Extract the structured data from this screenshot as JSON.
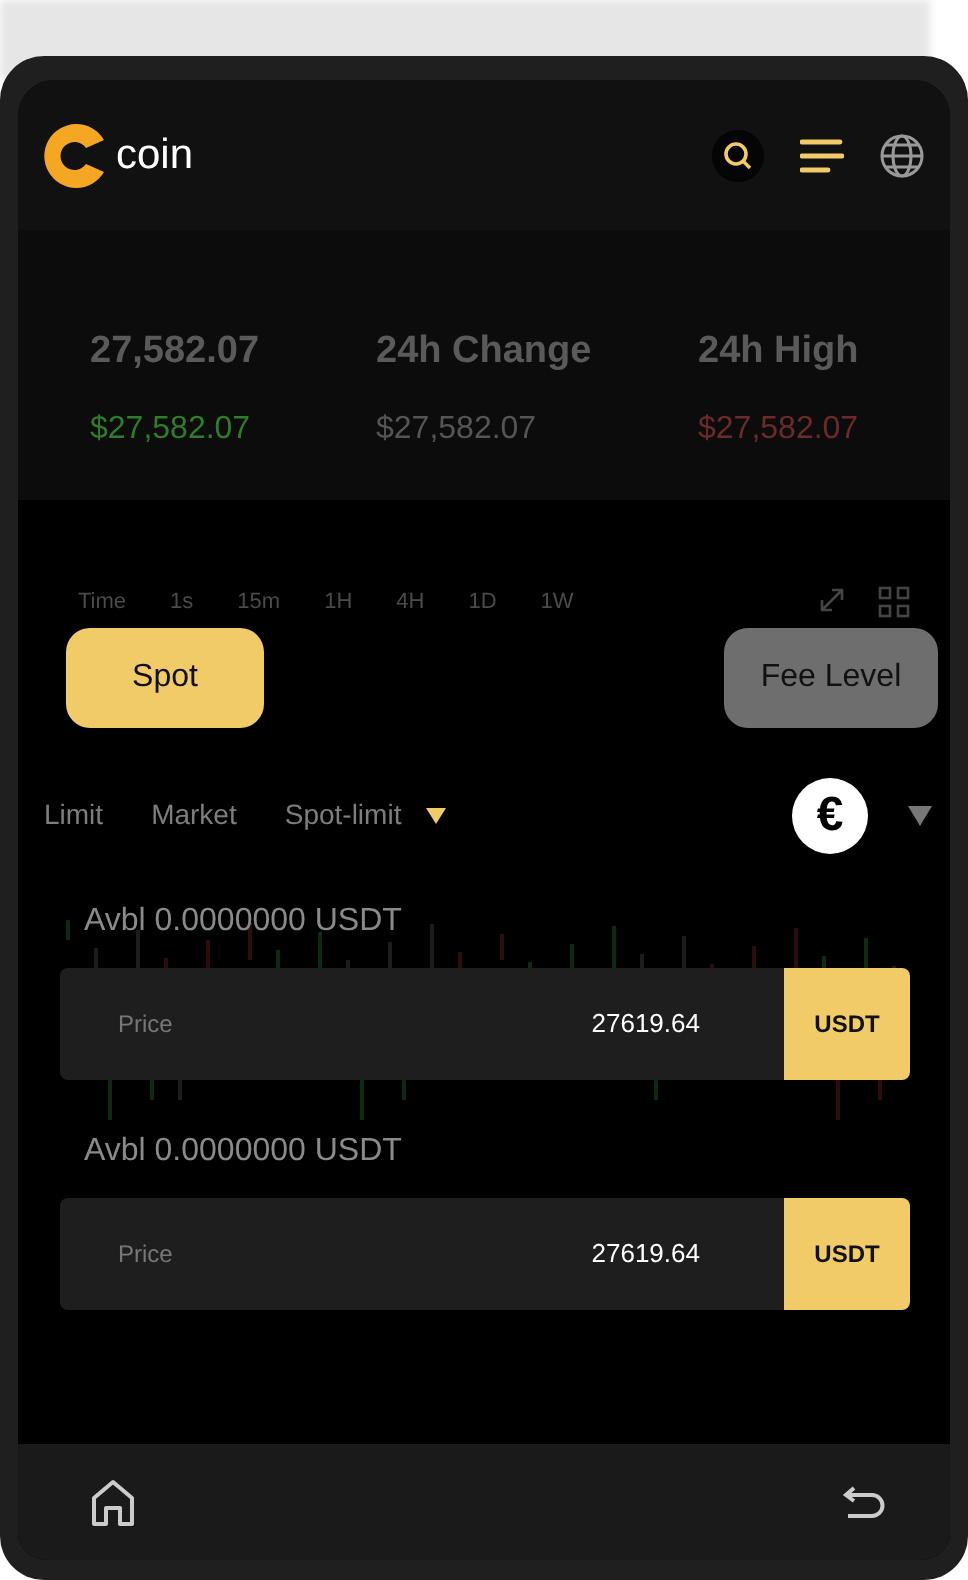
{
  "header": {
    "logo_text": "coin"
  },
  "stats": [
    {
      "title": "27,582.07",
      "price": "$27,582.07",
      "color": "#2f7d2b"
    },
    {
      "title": "24h Change",
      "price": "$27,582.07",
      "color": "#555555"
    },
    {
      "title": "24h High",
      "price": "$27,582.07",
      "color": "#6b2b2b"
    }
  ],
  "chart_toolbar": {
    "timeframes": [
      "Time",
      "1s",
      "15m",
      "1H",
      "4H",
      "1D",
      "1W"
    ]
  },
  "mode_buttons": [
    {
      "label": "Spot",
      "selected": true
    },
    {
      "label": "Fee Level",
      "selected": false
    }
  ],
  "order_types": [
    {
      "label": "Limit",
      "has_dropdown": false
    },
    {
      "label": "Market",
      "has_dropdown": false
    },
    {
      "label": "Spot-limit",
      "has_dropdown": true
    }
  ],
  "currency_button": {
    "symbol": "€"
  },
  "forms": [
    {
      "available": "Avbl 0.0000000 USDT",
      "label": "Price",
      "value": "27619.64",
      "unit": "USDT"
    },
    {
      "available": "Avbl 0.0000000 USDT",
      "label": "Price",
      "value": "27619.64",
      "unit": "USDT"
    }
  ]
}
